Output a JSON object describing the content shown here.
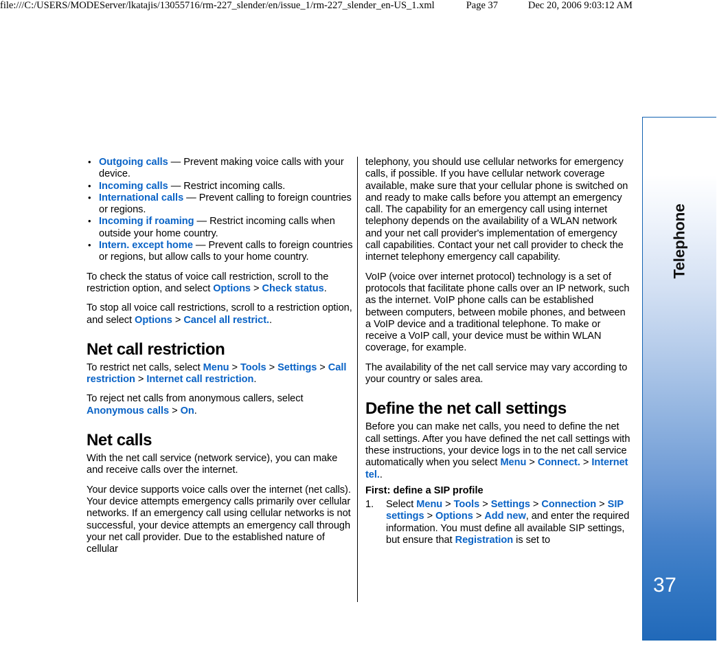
{
  "print_header": {
    "file_path": "file:///C:/USERS/MODEServer/lkatajis/13055716/rm-227_slender/en/issue_1/rm-227_slender_en-US_1.xml",
    "page_label": "Page 37",
    "timestamp": "Dec 20, 2006 9:03:12 AM"
  },
  "thumb_tab": {
    "chapter_label": "Telephone",
    "page_number": "37",
    "border_color": "#1060b0",
    "gradient_bottom_color": "#2169b9"
  },
  "colors": {
    "ui_link": "#0a63c6",
    "body_text": "#000000"
  },
  "left_column": {
    "bullets": [
      {
        "term": "Outgoing calls",
        "text": " — Prevent making voice calls with your device."
      },
      {
        "term": "Incoming calls",
        "text": " — Restrict incoming calls."
      },
      {
        "term": "International calls",
        "text": " — Prevent calling to foreign countries or regions."
      },
      {
        "term": "Incoming if roaming",
        "text": " — Restrict incoming calls when outside your home country."
      },
      {
        "term": "Intern. except home",
        "text": " — Prevent calls to foreign countries or regions, but allow calls to your home country."
      }
    ],
    "para_check_status": {
      "lead": "To check the status of voice call restriction, scroll to the restriction option, and select ",
      "ui1": "Options",
      "sep1": " > ",
      "ui2": "Check status",
      "tail": "."
    },
    "para_cancel_all": {
      "lead": "To stop all voice call restrictions, scroll to a restriction option, and select ",
      "ui1": "Options",
      "sep1": " > ",
      "ui2": "Cancel all restrict.",
      "tail": "."
    },
    "heading_net_call_restriction": "Net call restriction",
    "para_restrict_net_calls": {
      "lead": "To restrict net calls, select ",
      "ui1": "Menu",
      "sep1": " > ",
      "ui2": "Tools",
      "sep2": " > ",
      "ui3": "Settings",
      "sep3": " > ",
      "ui4": "Call restriction",
      "sep4": " > ",
      "ui5": "Internet call restriction",
      "tail": "."
    },
    "para_anonymous": {
      "lead": "To reject net calls from anonymous callers, select ",
      "ui1": "Anonymous calls",
      "sep1": " > ",
      "ui2": "On",
      "tail": "."
    },
    "heading_net_calls": "Net calls",
    "para_net_call_service": "With the net call service (network service), you can make and receive calls over the internet.",
    "para_supports_voip": "Your device supports voice calls over the internet (net calls). Your device attempts emergency calls primarily over cellular networks. If an emergency call using cellular networks is not successful, your device attempts an emergency call through your net call provider. Due to the established nature of cellular"
  },
  "right_column": {
    "para_telephony_continued": "telephony, you should use cellular networks for emergency calls, if possible. If you have cellular network coverage available, make sure that your cellular phone is switched on and ready to make calls before you attempt an emergency call. The capability for an emergency call using internet telephony depends on the availability of a WLAN network and your net call provider's implementation of emergency call capabilities. Contact your net call provider to check the internet telephony emergency call capability.",
    "para_voip": "VoIP (voice over internet protocol) technology is a set of protocols that facilitate phone calls over an IP network, such as the internet. VoIP phone calls can be established between computers, between mobile phones, and between a VoIP device and a traditional telephone. To make or receive a VoIP call, your device must be within WLAN coverage, for example.",
    "para_availability": "The availability of the net call service may vary according to your country or sales area.",
    "heading_define_settings": "Define the net call settings",
    "para_before_you_can": {
      "lead": "Before you can make net calls, you need to define the net call settings. After you have defined the net call settings with these instructions, your device logs in to the net call service automatically when you select ",
      "ui1": "Menu",
      "sep1": " > ",
      "ui2": "Connect.",
      "sep2": " > ",
      "ui3": "Internet tel.",
      "tail": "."
    },
    "subheading_sip_profile": "First: define a SIP profile",
    "step1": {
      "number": "1.",
      "lead": "Select ",
      "ui1": "Menu",
      "sep1": " > ",
      "ui2": "Tools",
      "sep2": " > ",
      "ui3": "Settings",
      "sep3": " > ",
      "ui4": "Connection",
      "sep4": " > ",
      "ui5": "SIP settings",
      "sep5": " > ",
      "ui6": "Options",
      "sep6": " > ",
      "ui7": "Add new",
      "mid": ", and enter the required information. You must define all available SIP settings, but ensure that ",
      "ui8": "Registration",
      "tail": " is set to"
    }
  }
}
